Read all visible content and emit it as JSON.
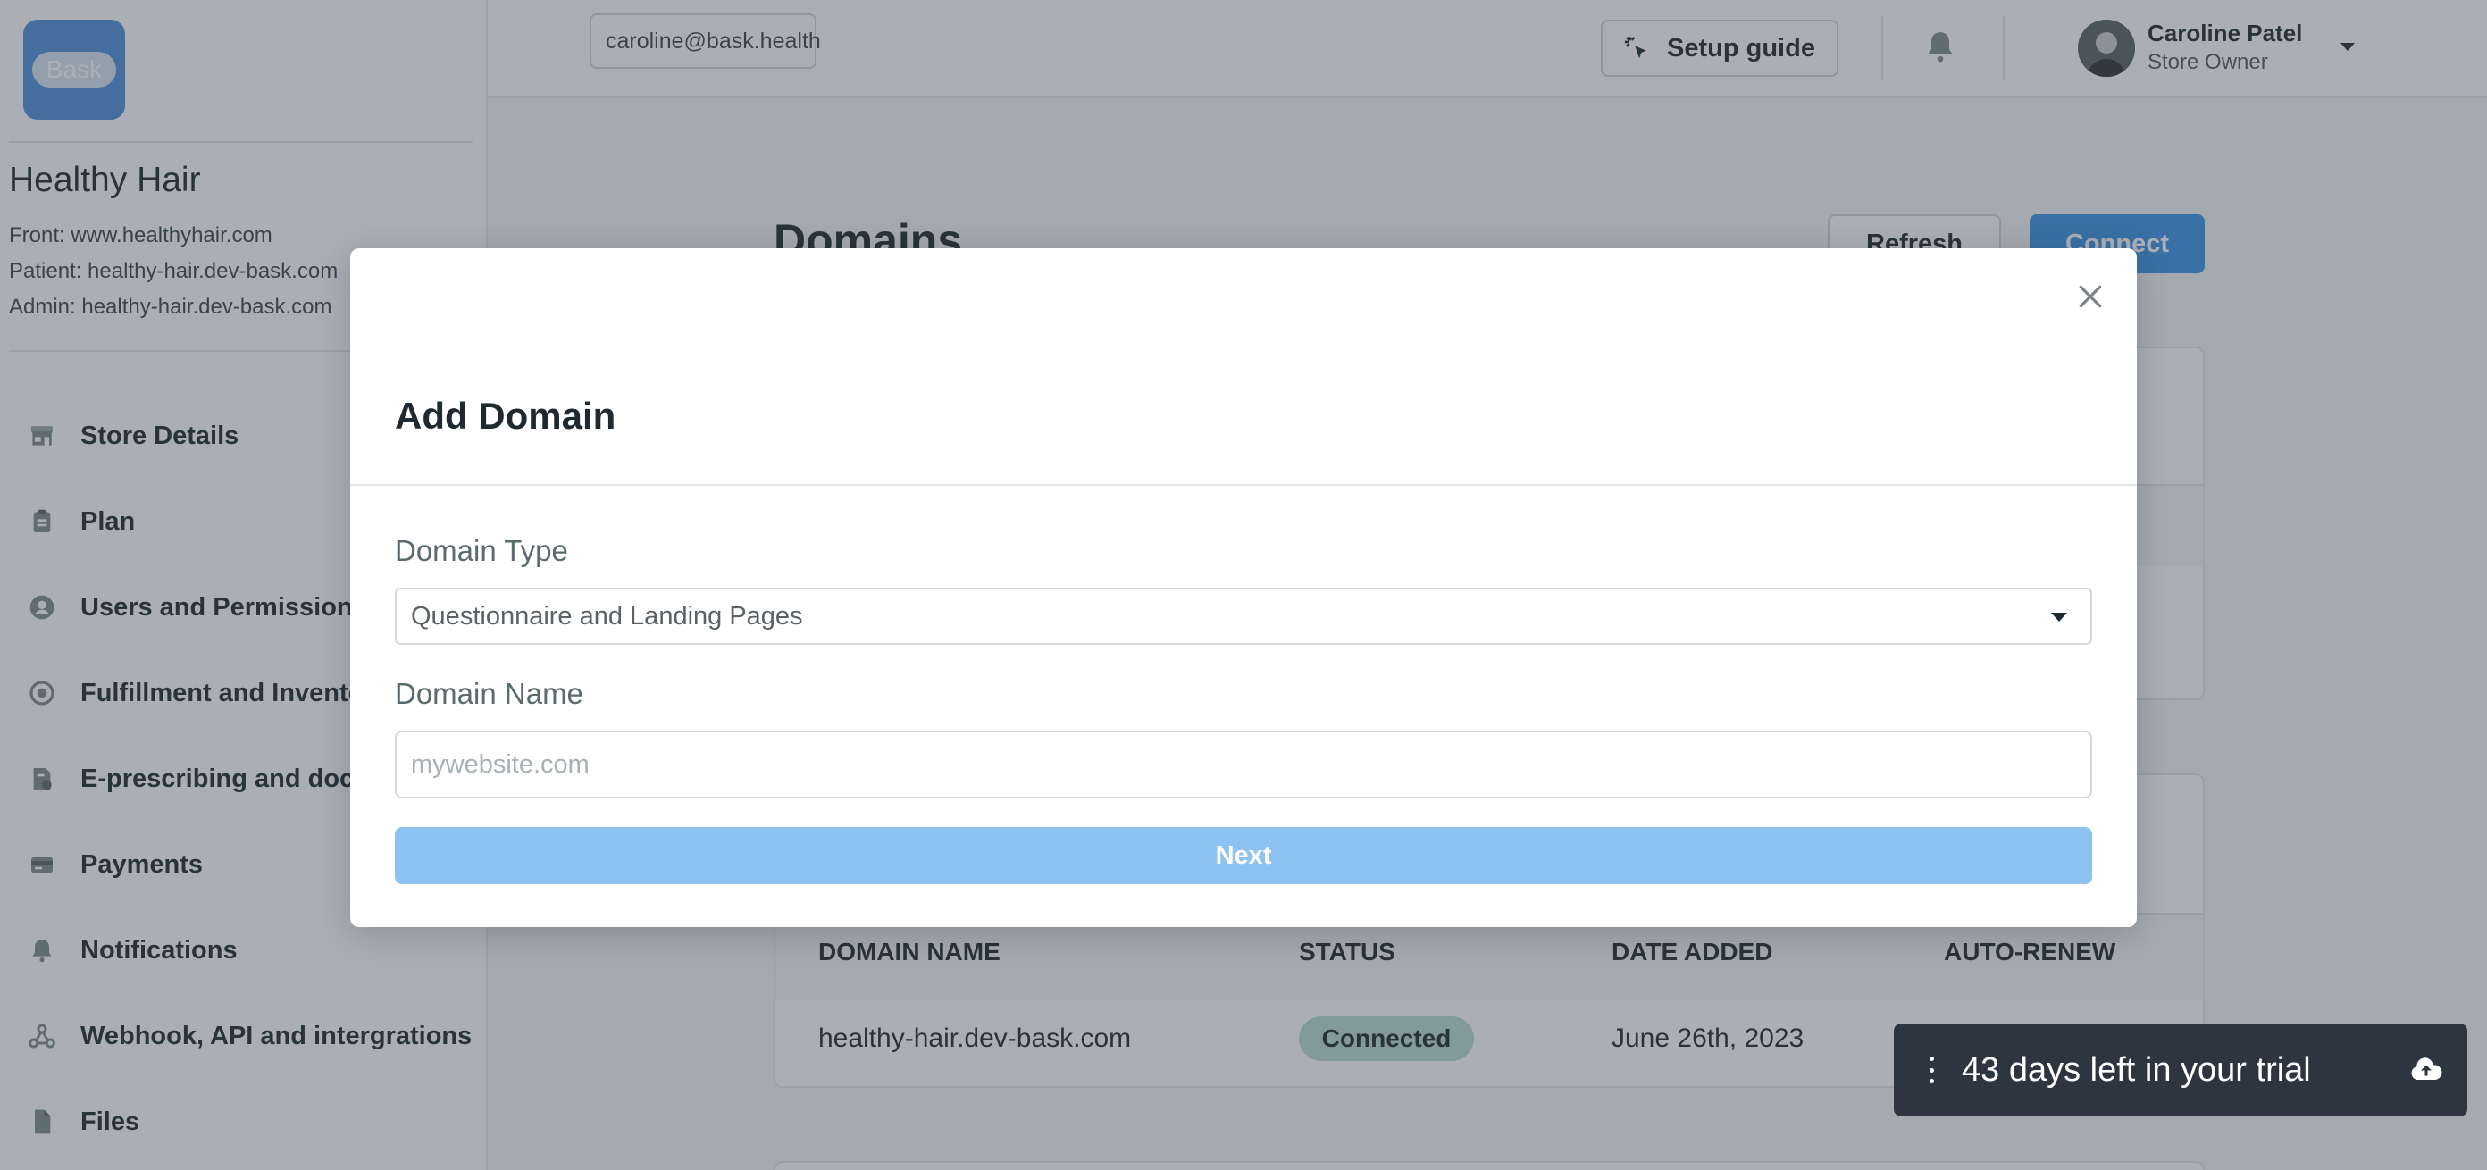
{
  "brand": {
    "logo_text": "Bask",
    "accent": "#4f90d8"
  },
  "store": {
    "name": "Healthy Hair",
    "front": "Front: www.healthyhair.com",
    "patient": "Patient: healthy-hair.dev-bask.com",
    "admin": "Admin: healthy-hair.dev-bask.com"
  },
  "sidebar": {
    "items": [
      {
        "label": "Store Details",
        "icon": "store-icon"
      },
      {
        "label": "Plan",
        "icon": "clipboard-icon"
      },
      {
        "label": "Users and Permissions",
        "icon": "user-icon"
      },
      {
        "label": "Fulfillment and Inventory",
        "icon": "fulfillment-icon"
      },
      {
        "label": "E-prescribing and doctors",
        "icon": "prescription-icon"
      },
      {
        "label": "Payments",
        "icon": "payment-card-icon"
      },
      {
        "label": "Notifications",
        "icon": "bell-icon"
      },
      {
        "label": "Webhook, API and intergrations",
        "icon": "webhook-icon"
      },
      {
        "label": "Files",
        "icon": "file-icon"
      }
    ]
  },
  "topbar": {
    "email": "caroline@bask.health",
    "setup_guide": "Setup guide",
    "user_name": "Caroline Patel",
    "user_role": "Store Owner"
  },
  "main": {
    "title": "Domains",
    "refresh_label": "Refresh",
    "connect_label": "Connect",
    "table": {
      "headers": [
        "DOMAIN NAME",
        "STATUS",
        "DATE ADDED",
        "AUTO-RENEW"
      ],
      "rows": [
        {
          "domain": "healthy-hair.dev-bask.com",
          "status": "Connected",
          "date": "June 26th, 2023"
        }
      ]
    }
  },
  "modal": {
    "title": "Add Domain",
    "domain_type_label": "Domain Type",
    "domain_type_value": "Questionnaire and Landing Pages",
    "domain_name_label": "Domain Name",
    "domain_name_placeholder": "mywebsite.com",
    "next_label": "Next"
  },
  "trial": {
    "text": "43 days left in your trial"
  },
  "colors": {
    "primary": "#3b95e6",
    "primary_disabled": "#8cc3f3",
    "status_connected": "#b9dccd",
    "toast_bg": "#2c3540"
  }
}
